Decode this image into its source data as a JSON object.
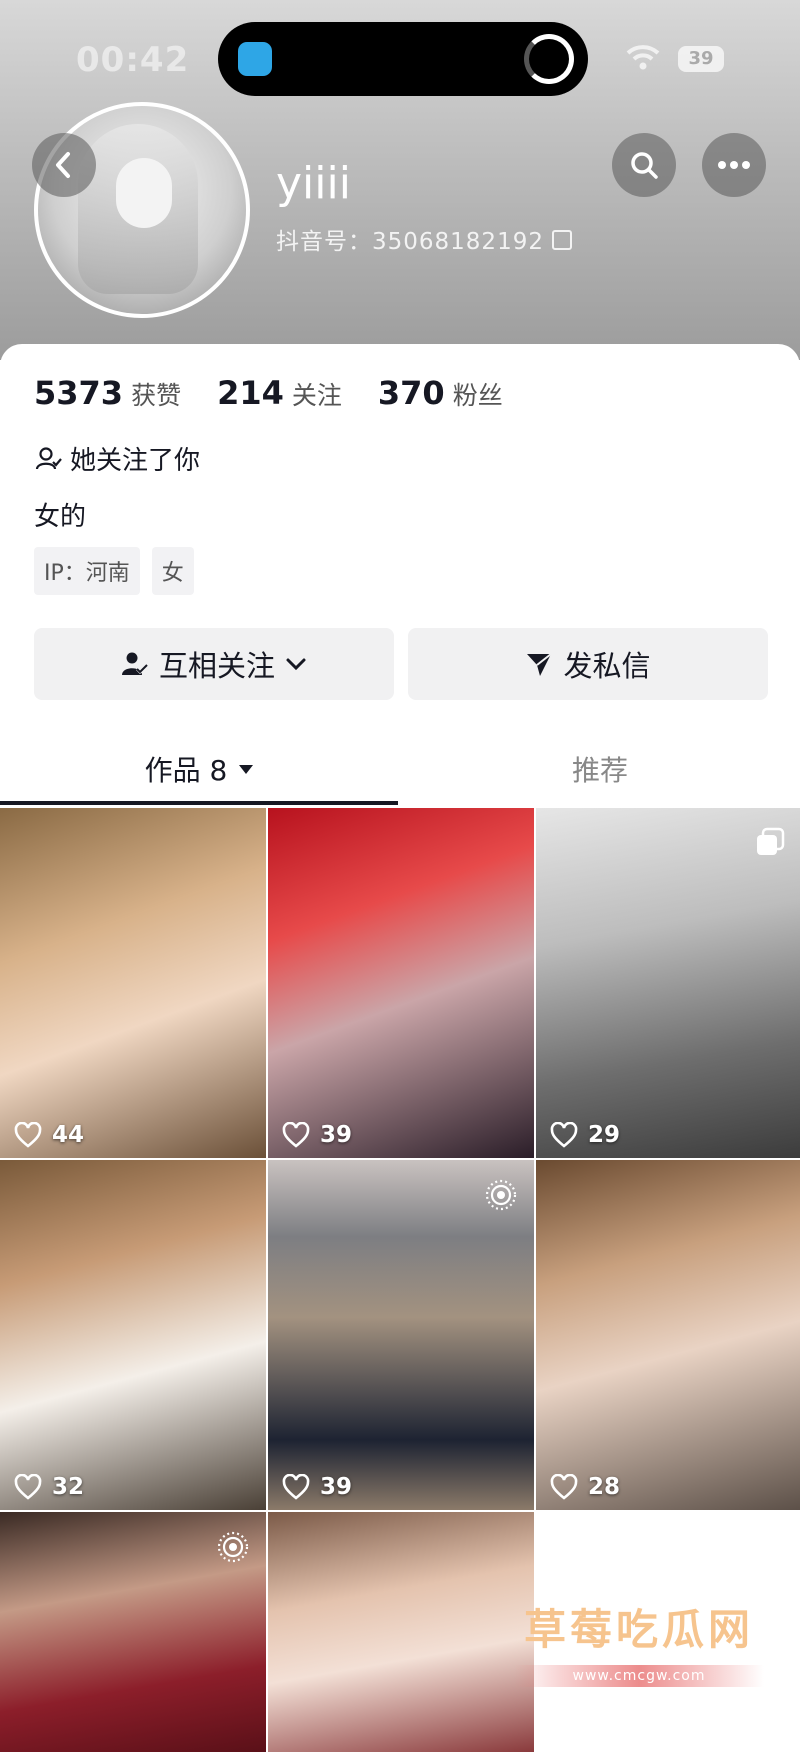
{
  "status_bar": {
    "time": "00:42",
    "battery": "39"
  },
  "profile": {
    "nickname": "yiiii",
    "douyin_id": "抖音号：35068182192",
    "stats": [
      {
        "value": "5373",
        "label": "获赞"
      },
      {
        "value": "214",
        "label": "关注"
      },
      {
        "value": "370",
        "label": "粉丝"
      }
    ],
    "follow_note": "她关注了你",
    "bio": "女的",
    "tags": [
      "IP：河南",
      "女"
    ]
  },
  "actions": {
    "mutual_follow": "互相关注",
    "message": "发私信"
  },
  "tabs": {
    "works": "作品 8",
    "recommend": "推荐"
  },
  "videos": [
    {
      "likes": "44"
    },
    {
      "likes": "39"
    },
    {
      "likes": "29"
    },
    {
      "likes": "32"
    },
    {
      "likes": "39"
    },
    {
      "likes": "28"
    },
    {
      "likes": ""
    },
    {
      "likes": ""
    }
  ],
  "watermark": {
    "title": "草莓吃瓜网",
    "url": "www.cmcgw.com"
  },
  "colors": {
    "text": "#161823",
    "secondary": "#888888",
    "button_bg": "#f1f1f2"
  }
}
